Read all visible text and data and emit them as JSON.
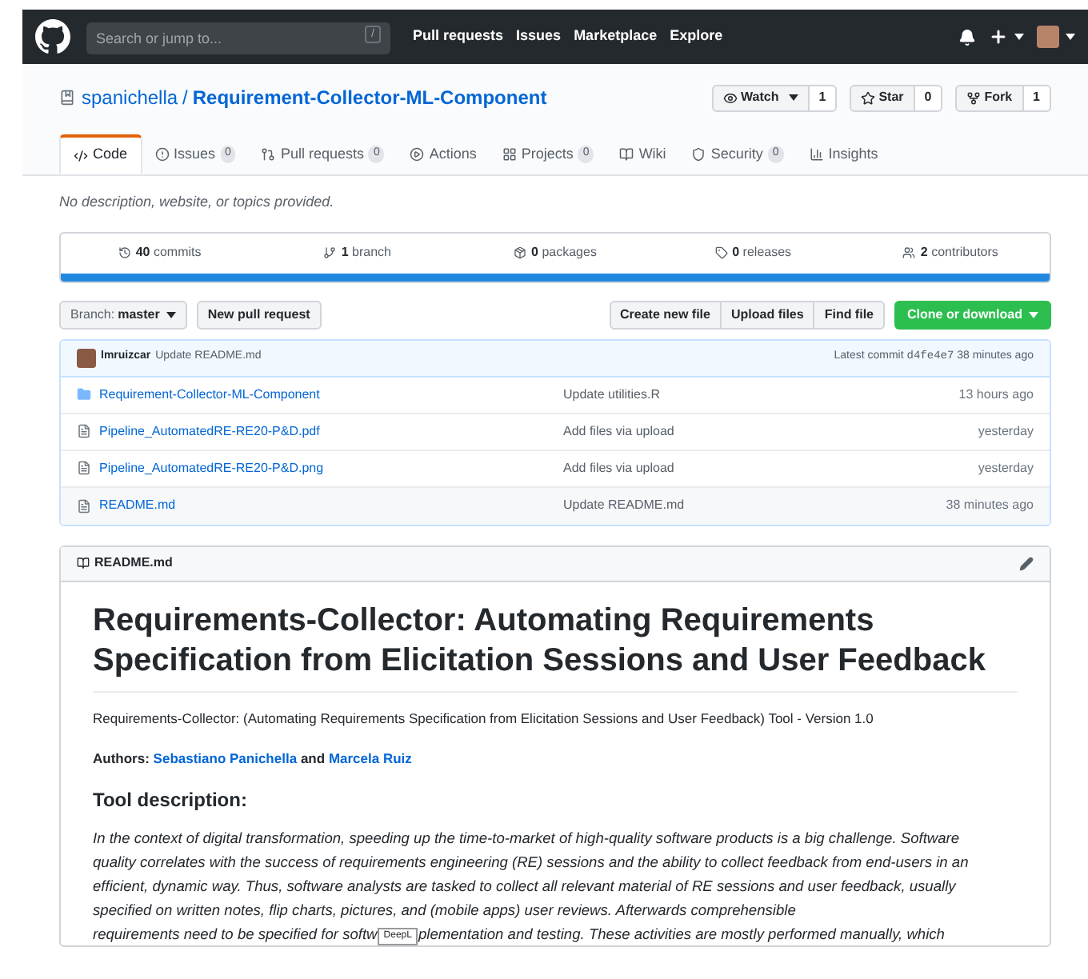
{
  "header": {
    "search_placeholder": "Search or jump to...",
    "search_key": "/",
    "nav": [
      "Pull requests",
      "Issues",
      "Marketplace",
      "Explore"
    ]
  },
  "repo": {
    "owner": "spanichella",
    "separator": "/",
    "name": "Requirement-Collector-ML-Component",
    "actions": [
      {
        "kind": "watch",
        "label": "Watch",
        "count": "1"
      },
      {
        "kind": "star",
        "label": "Star",
        "count": "0"
      },
      {
        "kind": "fork",
        "label": "Fork",
        "count": "1"
      }
    ]
  },
  "tabs": [
    {
      "kind": "code",
      "label": "Code",
      "selected": true
    },
    {
      "kind": "issues",
      "label": "Issues",
      "count": "0",
      "selected": false
    },
    {
      "kind": "pr",
      "label": "Pull requests",
      "count": "0",
      "selected": false
    },
    {
      "kind": "actions",
      "label": "Actions",
      "selected": false
    },
    {
      "kind": "projects",
      "label": "Projects",
      "count": "0",
      "selected": false
    },
    {
      "kind": "wiki",
      "label": "Wiki",
      "selected": false
    },
    {
      "kind": "security",
      "label": "Security",
      "count": "0",
      "selected": false
    },
    {
      "kind": "insights",
      "label": "Insights",
      "selected": false
    }
  ],
  "description": "No description, website, or topics provided.",
  "stats": [
    {
      "kind": "commits",
      "count": "40",
      "label": "commits"
    },
    {
      "kind": "branch",
      "count": "1",
      "label": "branch"
    },
    {
      "kind": "packages",
      "count": "0",
      "label": "packages"
    },
    {
      "kind": "releases",
      "count": "0",
      "label": "releases"
    },
    {
      "kind": "contributors",
      "count": "2",
      "label": "contributors"
    }
  ],
  "branch": {
    "prefix": "Branch:",
    "name": "master"
  },
  "new_pr": "New pull request",
  "file_buttons": [
    "Create new file",
    "Upload files",
    "Find file"
  ],
  "clone": "Clone or download",
  "latest_commit": {
    "author": "lmruizcar",
    "message": "Update README.md",
    "prefix": "Latest commit",
    "sha": "d4fe4e7",
    "time": "38 minutes ago"
  },
  "files": [
    {
      "kind": "folder",
      "name": "Requirement-Collector-ML-Component",
      "message": "Update utilities.R",
      "time": "13 hours ago"
    },
    {
      "kind": "file",
      "name": "Pipeline_AutomatedRE-RE20-P&D.pdf",
      "message": "Add files via upload",
      "time": "yesterday"
    },
    {
      "kind": "file",
      "name": "Pipeline_AutomatedRE-RE20-P&D.png",
      "message": "Add files via upload",
      "time": "yesterday"
    },
    {
      "kind": "file",
      "name": "README.md",
      "message": "Update README.md",
      "time": "38 minutes ago"
    }
  ],
  "readme": {
    "filename": "README.md",
    "title": "Requirements-Collector: Automating Requirements Specification from Elicitation Sessions and User Feedback",
    "subtitle": "Requirements-Collector: (Automating Requirements Specification from Elicitation Sessions and User Feedback) Tool - Version 1.0",
    "authors_label": "Authors:",
    "authors": [
      "Sebastiano Panichella",
      "Marcela Ruiz"
    ],
    "authors_joiner": "and",
    "section": "Tool description:",
    "paragraph": "In the context of digital transformation, speeding up the time-to-market of high-quality software products is a big challenge. Software quality correlates with the success of requirements engineering (RE) sessions and the ability to collect feedback from end-users in an efficient, dynamic way. Thus, software analysts are tasked to collect all relevant material of RE sessions and user feedback, usually specified on written notes, flip charts, pictures, and (mobile apps) user reviews. Afterwards comprehensible",
    "last_line_start": "requirements need to be specified for softw",
    "last_line_end": "plementation and testing. These activities are mostly performed manually, which",
    "tooltip": "DeepL"
  }
}
